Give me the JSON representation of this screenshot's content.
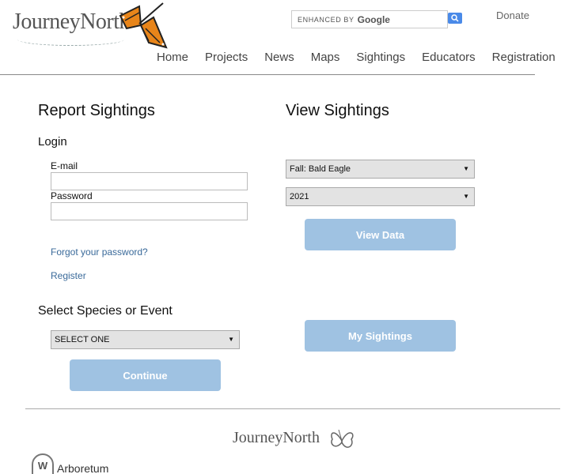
{
  "header": {
    "logo_text": "JourneyNorth",
    "search_enhanced": "ENHANCED BY",
    "search_brand": "Google",
    "donate": "Donate",
    "nav": [
      "Home",
      "Projects",
      "News",
      "Maps",
      "Sightings",
      "Educators",
      "Registration"
    ]
  },
  "report": {
    "title": "Report Sightings",
    "login_heading": "Login",
    "email_label": "E-mail",
    "password_label": "Password",
    "forgot_link": "Forgot your password?",
    "register_link": "Register",
    "species_heading": "Select Species or Event",
    "species_select": "SELECT ONE",
    "continue_button": "Continue"
  },
  "view": {
    "title": "View Sightings",
    "species_select": "Fall: Bald Eagle",
    "year_select": "2021",
    "view_data_button": "View Data",
    "my_sightings_button": "My Sightings"
  },
  "footer": {
    "logo_text": "JourneyNorth",
    "badge_letter": "W",
    "arboretum_text": "Arboretum"
  },
  "colors": {
    "button_bg": "#9fc2e2",
    "link": "#3a6a9a",
    "search_button": "#4a8ae8",
    "butterfly_orange": "#e8851a"
  }
}
